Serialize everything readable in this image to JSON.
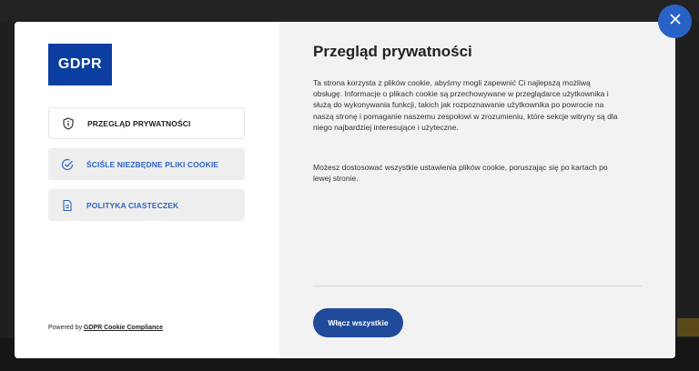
{
  "modal": {
    "logo_text": "GDPR",
    "tabs": [
      {
        "label": "PRZEGLĄD PRYWATNOŚCI",
        "icon": "info-shield-icon",
        "active": true
      },
      {
        "label": "ŚCIŚLE NIEZBĘDNE PLIKI COOKIE",
        "icon": "check-circle-icon",
        "active": false
      },
      {
        "label": "POLITYKA CIASTECZEK",
        "icon": "document-icon",
        "active": false
      }
    ],
    "powered_prefix": "Powered by",
    "powered_link": "GDPR Cookie Compliance",
    "title": "Przegląd prywatności",
    "paragraph1": "Ta strona korzysta z plików cookie, abyśmy mogli zapewnić Ci najlepszą możliwą obsługę. Informacje o plikach cookie są przechowywane w przeglądarce użytkownika i służą do wykonywania funkcji, takich jak rozpoznawanie użytkownika po powrocie na naszą stronę i pomaganie naszemu zespołowi w zrozumieniu, które sekcje witryny są dla niego najbardziej interesujące i użyteczne.",
    "paragraph2": "Możesz dostosować wszystkie ustawienia plików cookie, poruszając się po kartach po lewej stronie.",
    "enable_all_label": "Włącz wszystkie"
  },
  "colors": {
    "brand_blue": "#0b3ea0",
    "button_blue": "#1f4b9a",
    "close_blue": "#2962c7",
    "link_blue": "#2f63c7"
  }
}
